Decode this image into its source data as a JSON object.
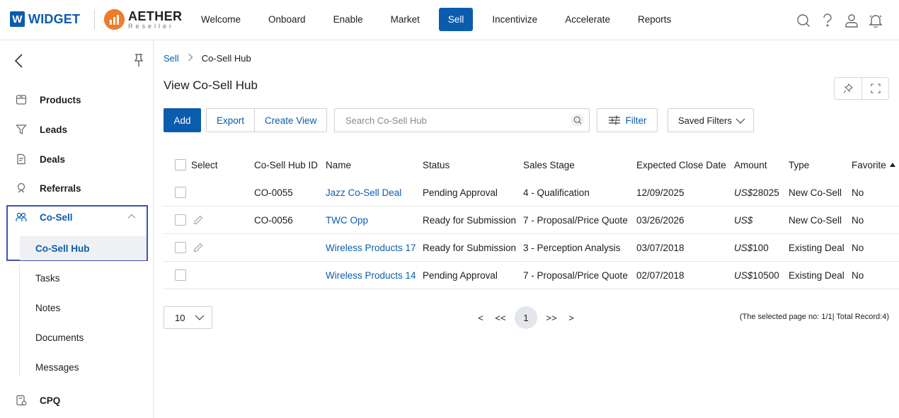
{
  "brand": {
    "widget_mark": "W",
    "widget_name": "WIDGET",
    "aether_name": "AETHER",
    "aether_sub": "Reseller"
  },
  "nav": {
    "items": [
      {
        "label": "Welcome"
      },
      {
        "label": "Onboard"
      },
      {
        "label": "Enable"
      },
      {
        "label": "Market"
      },
      {
        "label": "Sell"
      },
      {
        "label": "Incentivize"
      },
      {
        "label": "Accelerate"
      },
      {
        "label": "Reports"
      }
    ],
    "active": "Sell",
    "icons": [
      "search-icon",
      "help-icon",
      "user-icon",
      "notification-bell-icon"
    ]
  },
  "sidebar": {
    "items": [
      {
        "label": "Products",
        "icon": "products-icon"
      },
      {
        "label": "Leads",
        "icon": "leads-funnel-icon"
      },
      {
        "label": "Deals",
        "icon": "deals-icon"
      },
      {
        "label": "Referrals",
        "icon": "referrals-icon"
      },
      {
        "label": "Co-Sell",
        "icon": "co-sell-icon"
      },
      {
        "label": "CPQ",
        "icon": "cpq-icon"
      }
    ],
    "cosell_sub": [
      {
        "label": "Co-Sell Hub"
      },
      {
        "label": "Tasks"
      },
      {
        "label": "Notes"
      },
      {
        "label": "Documents"
      },
      {
        "label": "Messages"
      }
    ]
  },
  "breadcrumb": {
    "parent": "Sell",
    "current": "Co-Sell Hub"
  },
  "page": {
    "title": "View Co-Sell Hub"
  },
  "toolbar": {
    "add_label": "Add",
    "export_label": "Export",
    "create_view_label": "Create View",
    "search_placeholder": "Search Co-Sell Hub",
    "filter_label": "Filter",
    "saved_filters_label": "Saved Filters"
  },
  "table": {
    "columns": {
      "select": "Select",
      "id": "Co-Sell Hub ID",
      "name": "Name",
      "status": "Status",
      "stage": "Sales Stage",
      "close_date": "Expected Close Date",
      "amount": "Amount",
      "type": "Type",
      "favorite": "Favorite"
    },
    "rows": [
      {
        "id": "CO-0055",
        "name": "Jazz Co-Sell Deal",
        "status": "Pending Approval",
        "stage": "4 - Qualification",
        "close_date": "12/09/2025",
        "currency": "US$",
        "amount": "28025",
        "type": "New Co-Sell",
        "favorite": "No",
        "editable": false
      },
      {
        "id": "CO-0056",
        "name": "TWC Opp",
        "status": "Ready for Submission",
        "stage": "7 - Proposal/Price Quote",
        "close_date": "03/26/2026",
        "currency": "US$",
        "amount": "",
        "type": "New Co-Sell",
        "favorite": "No",
        "editable": true
      },
      {
        "id": "",
        "name": "Wireless Products 17",
        "status": "Ready for Submission",
        "stage": "3 - Perception Analysis",
        "close_date": "03/07/2018",
        "currency": "US$",
        "amount": "100",
        "type": "Existing Deal",
        "favorite": "No",
        "editable": true
      },
      {
        "id": "",
        "name": "Wireless Products 14",
        "status": "Pending Approval",
        "stage": "7 - Proposal/Price Quote",
        "close_date": "02/07/2018",
        "currency": "US$",
        "amount": "10500",
        "type": "Existing Deal",
        "favorite": "No",
        "editable": false
      }
    ]
  },
  "pagination": {
    "page_size": "10",
    "prev": "<",
    "first": "<<",
    "current": "1",
    "last": ">>",
    "next": ">",
    "info": "(The selected page no: 1/1| Total Record:4)"
  },
  "colors": {
    "brand_blue": "#0b5cad",
    "aether_orange": "#ef7b2c",
    "highlight_border": "#3f51b5"
  }
}
